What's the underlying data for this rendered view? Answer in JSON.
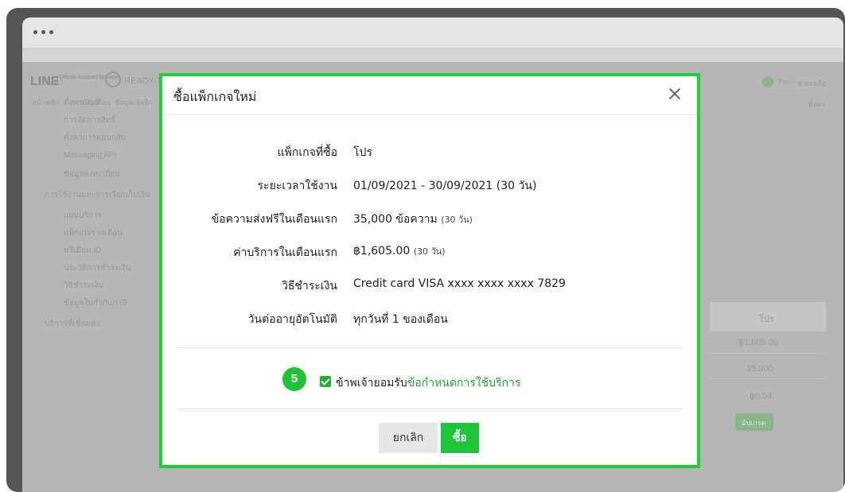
{
  "background": {
    "logo": "LINE",
    "logo_sub": "Official Account Manager",
    "account": "READY-TO",
    "nav_tabs": [
      "หน้าหลัก",
      "การแจ้งเตือน",
      "ข้อมูลเชิงลึก"
    ],
    "sidebar": [
      "ตั้งค่า",
      "ตั้งค่าบัญชี",
      "การจัดการสิทธิ์",
      "ตั้งค่าการตอบกลับ",
      "Messaging API",
      "ข้อมูลลงทะเบียน",
      "การใช้งานและการเรียกเก็บเงิน",
      "แผนบริการ",
      "แพ็กเกจรายเดือน",
      "พรีเมียม ID",
      "ประวัติการชำระเงิน",
      "วิธีชำระเงิน",
      "ข้อมูลใบกำกับภาษี",
      "บริการที่เชื่อมต่อ"
    ],
    "table_col_header": "โปร",
    "table_values": [
      "฿1,605.00",
      "35,000",
      "฿0.04"
    ],
    "update_button": "อัปเกรด",
    "top_right": [
      "Pro",
      "ช่วยเหลือ"
    ],
    "settings_link": "ตั้งค่า"
  },
  "modal": {
    "title": "ซื้อแพ็กเกจใหม่",
    "rows": [
      {
        "label": "แพ็กเกจที่ซื้อ",
        "value": "โปร",
        "note": ""
      },
      {
        "label": "ระยะเวลาใช้งาน",
        "value": "01/09/2021 - 30/09/2021 (30 วัน)",
        "note": ""
      },
      {
        "label": "ข้อความส่งฟรีในเดือนแรก",
        "value": "35,000 ข้อความ",
        "note": "(30 วัน)"
      },
      {
        "label": "ค่าบริการในเดือนแรก",
        "value": "฿1,605.00",
        "note": "(30 วัน)"
      },
      {
        "label": "วิธีชำระเงิน",
        "value": "Credit card VISA xxxx xxxx xxxx 7829",
        "note": ""
      },
      {
        "label": "วันต่ออายุอัตโนมัติ",
        "value": "ทุกวันที่ 1 ของเดือน",
        "note": ""
      }
    ],
    "step_badge": "5",
    "agree_text": "ข้าพเจ้ายอมรับ",
    "agree_link": "ข้อกำหนดการใช้บริการ",
    "cancel_label": "ยกเลิก",
    "buy_label": "ซื้อ",
    "highlight_color": "#22cc33"
  }
}
